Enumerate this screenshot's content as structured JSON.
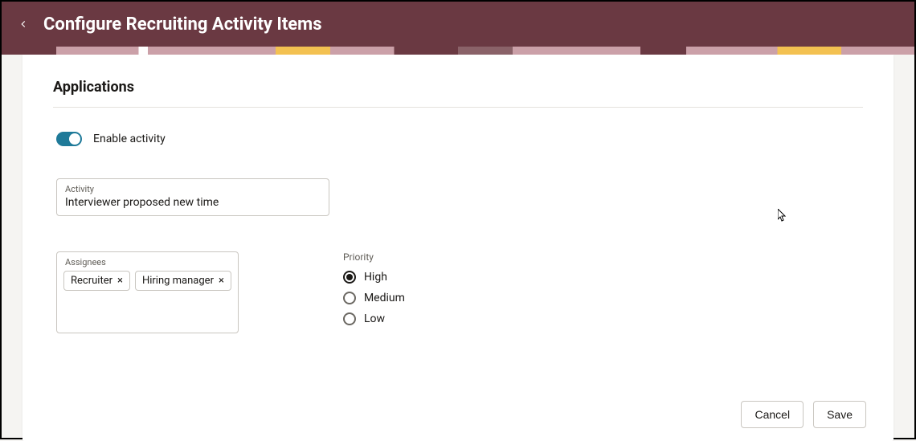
{
  "header": {
    "title": "Configure Recruiting Activity Items"
  },
  "section": {
    "heading": "Applications"
  },
  "toggle": {
    "label": "Enable activity",
    "enabled": true
  },
  "activity_field": {
    "label": "Activity",
    "value": "Interviewer proposed new time"
  },
  "assignees": {
    "label": "Assignees",
    "chips": [
      {
        "label": "Recruiter"
      },
      {
        "label": "Hiring manager"
      }
    ]
  },
  "priority": {
    "label": "Priority",
    "options": [
      {
        "label": "High",
        "selected": true
      },
      {
        "label": "Medium",
        "selected": false
      },
      {
        "label": "Low",
        "selected": false
      }
    ]
  },
  "buttons": {
    "cancel": "Cancel",
    "save": "Save"
  }
}
